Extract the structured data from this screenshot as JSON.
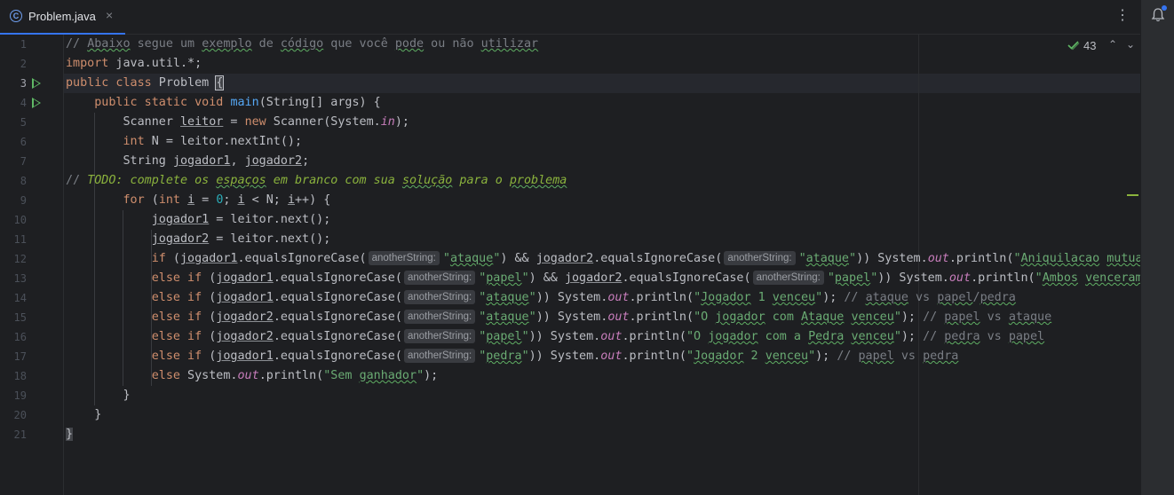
{
  "tab": {
    "file_icon": "C",
    "label": "Problem.java",
    "close": "×"
  },
  "toolbar": {
    "more": "⋮"
  },
  "inspections": {
    "count": "43",
    "up": "⌃",
    "down": "⌄"
  },
  "editor": {
    "line_numbers": [
      "1",
      "2",
      "3",
      "4",
      "5",
      "6",
      "7",
      "8",
      "9",
      "10",
      "11",
      "12",
      "13",
      "14",
      "15",
      "16",
      "17",
      "18",
      "19",
      "20",
      "21"
    ],
    "active_line": "3",
    "hint_label": "anotherString:"
  }
}
